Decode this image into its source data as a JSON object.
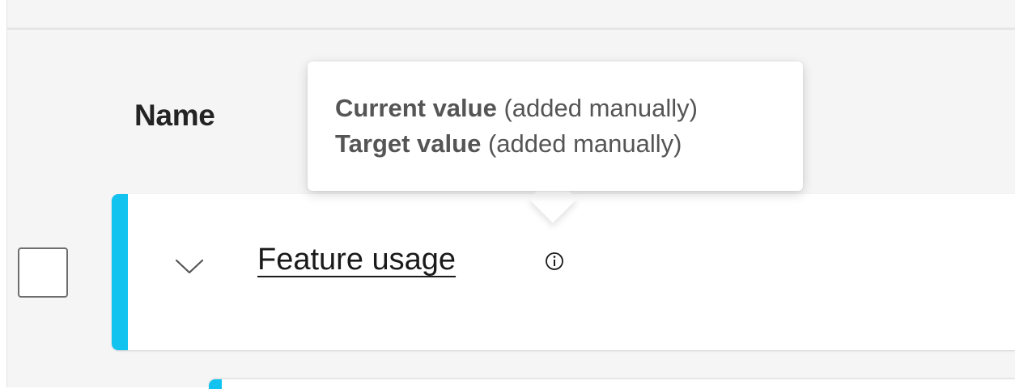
{
  "table": {
    "header": {
      "name_label": "Name"
    },
    "row": {
      "title": "Feature usage",
      "accent_color": "#12c2ef",
      "expand_icon": "chevron-down-icon",
      "info_icon": "info-icon"
    }
  },
  "tooltip": {
    "lines": [
      {
        "label": "Current value",
        "note": "(added manually)"
      },
      {
        "label": "Target value",
        "note": "(added manually)"
      }
    ]
  }
}
